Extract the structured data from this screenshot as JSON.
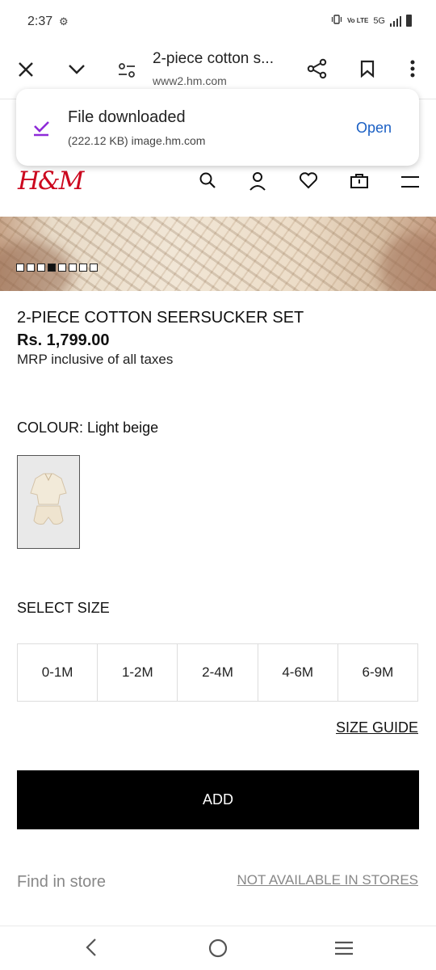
{
  "status": {
    "time": "2:37",
    "network": "5G",
    "volte": "Vo LTE"
  },
  "toolbar": {
    "title": "2-piece cotton s...",
    "url": "www2.hm.com"
  },
  "toast": {
    "title": "File downloaded",
    "subtitle": "(222.12 KB) image.hm.com",
    "action": "Open"
  },
  "brand": {
    "logo": "H&M",
    "color": "#cc071e"
  },
  "gallery": {
    "image_count": 8,
    "active_index": 3
  },
  "product": {
    "title": "2-PIECE COTTON SEERSUCKER SET",
    "price": "Rs. 1,799.00",
    "tax_note": "MRP inclusive of all taxes",
    "colour_label": "COLOUR:",
    "colour_value": "Light beige"
  },
  "sizes": {
    "heading": "SELECT SIZE",
    "options": [
      "0-1M",
      "1-2M",
      "2-4M",
      "4-6M",
      "6-9M"
    ],
    "guide": "SIZE GUIDE"
  },
  "actions": {
    "add": "ADD",
    "find_store": "Find in store",
    "availability": "NOT AVAILABLE IN STORES"
  },
  "icons": {
    "toolbar": [
      "close-icon",
      "chevron-down-icon",
      "page-settings-icon",
      "share-icon",
      "bookmark-icon",
      "more-icon"
    ],
    "header": [
      "search-icon",
      "account-icon",
      "heart-icon",
      "bag-icon",
      "menu-icon"
    ],
    "nav": [
      "back-icon",
      "home-icon",
      "recents-icon"
    ]
  },
  "colors": {
    "accent_link": "#1a5fc4",
    "download_check": "#8e2bd8",
    "add_button": "#000000"
  }
}
